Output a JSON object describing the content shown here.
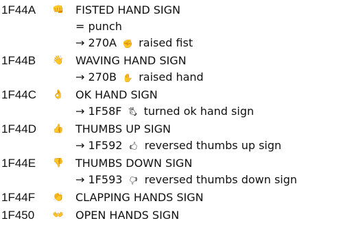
{
  "entries": [
    {
      "code": "1F44A",
      "glyph": "👊",
      "glyph_icon": "fisted-hand-icon",
      "name": "FISTED HAND SIGN",
      "alias": "= punch",
      "xref": {
        "arrow": "→",
        "code": "270A",
        "glyph": "✊",
        "glyph_icon": "raised-fist-icon",
        "name": "raised fist"
      }
    },
    {
      "code": "1F44B",
      "glyph": "👋",
      "glyph_icon": "waving-hand-icon",
      "name": "WAVING HAND SIGN",
      "xref": {
        "arrow": "→",
        "code": "270B",
        "glyph": "✋",
        "glyph_icon": "raised-hand-icon",
        "name": "raised hand"
      }
    },
    {
      "code": "1F44C",
      "glyph": "👌",
      "glyph_icon": "ok-hand-icon",
      "name": "OK HAND SIGN",
      "xref": {
        "arrow": "→",
        "code": "1F58F",
        "glyph": "🖏",
        "glyph_icon": "turned-ok-hand-icon",
        "name": "turned ok hand sign"
      }
    },
    {
      "code": "1F44D",
      "glyph": "👍",
      "glyph_icon": "thumbs-up-icon",
      "name": "THUMBS UP SIGN",
      "xref": {
        "arrow": "→",
        "code": "1F592",
        "glyph": "🖒",
        "glyph_icon": "reversed-thumbs-up-icon",
        "name": "reversed thumbs up sign"
      }
    },
    {
      "code": "1F44E",
      "glyph": "👎",
      "glyph_icon": "thumbs-down-icon",
      "name": "THUMBS DOWN SIGN",
      "xref": {
        "arrow": "→",
        "code": "1F593",
        "glyph": "🖓",
        "glyph_icon": "reversed-thumbs-down-icon",
        "name": "reversed thumbs down sign"
      }
    },
    {
      "code": "1F44F",
      "glyph": "👏",
      "glyph_icon": "clapping-hands-icon",
      "name": "CLAPPING HANDS SIGN"
    },
    {
      "code": "1F450",
      "glyph": "👐",
      "glyph_icon": "open-hands-icon",
      "name": "OPEN HANDS SIGN"
    }
  ]
}
